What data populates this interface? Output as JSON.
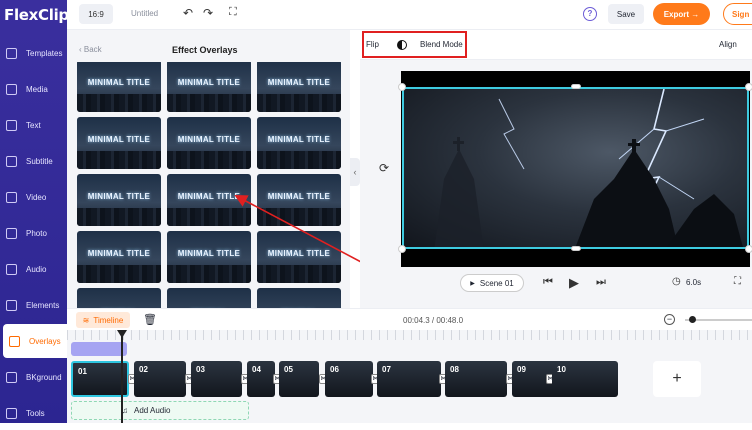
{
  "app": {
    "logo": "FlexClip"
  },
  "sidebar": {
    "items": [
      {
        "label": "Templates"
      },
      {
        "label": "Media"
      },
      {
        "label": "Text"
      },
      {
        "label": "Subtitle"
      },
      {
        "label": "Video"
      },
      {
        "label": "Photo"
      },
      {
        "label": "Audio"
      },
      {
        "label": "Elements"
      },
      {
        "label": "Overlays",
        "active": true
      },
      {
        "label": "BKground"
      },
      {
        "label": "Tools"
      }
    ]
  },
  "topbar": {
    "ratio": "16:9",
    "title": "Untitled",
    "undo_icon": "undo-icon",
    "redo_icon": "redo-icon",
    "fullscreen_icon": "fullscreen-icon",
    "help_icon": "help-icon",
    "save": "Save",
    "export": "Export →",
    "signin": "Sign"
  },
  "panel": {
    "back": "Back",
    "title": "Effect Overlays",
    "thumbs": [
      {
        "label": "MINIMAL TITLE"
      },
      {
        "label": "MINIMAL TITLE"
      },
      {
        "label": "MINIMAL TITLE"
      },
      {
        "label": "MINIMAL TITLE"
      },
      {
        "label": "MINIMAL TITLE"
      },
      {
        "label": "MINIMAL TITLE"
      },
      {
        "label": "MINIMAL TITLE"
      },
      {
        "label": "MINIMAL TITLE"
      },
      {
        "label": "MINIMAL TITLE"
      },
      {
        "label": "MINIMAL TITLE"
      },
      {
        "label": "MINIMAL TITLE"
      },
      {
        "label": "MINIMAL TITLE"
      },
      {
        "label": "MINIMAL"
      },
      {
        "label": "MINIMAL"
      },
      {
        "label": "MINIMAL"
      }
    ]
  },
  "preview": {
    "flip": "Flip",
    "blend_mode": "Blend Mode",
    "align": "Align",
    "scene": "Scene 01",
    "duration": "6.0s"
  },
  "timeline": {
    "button": "Timeline",
    "time": "00:04.3 / 00:48.0",
    "clips": [
      "01",
      "02",
      "03",
      "04",
      "05",
      "06",
      "07",
      "08",
      "09",
      "10"
    ],
    "add_audio": "Add Audio"
  },
  "colors": {
    "accent": "#ff7a1a",
    "sidebar": "#2c2591",
    "selection": "#3ecbe0",
    "annotation": "#e02020"
  }
}
